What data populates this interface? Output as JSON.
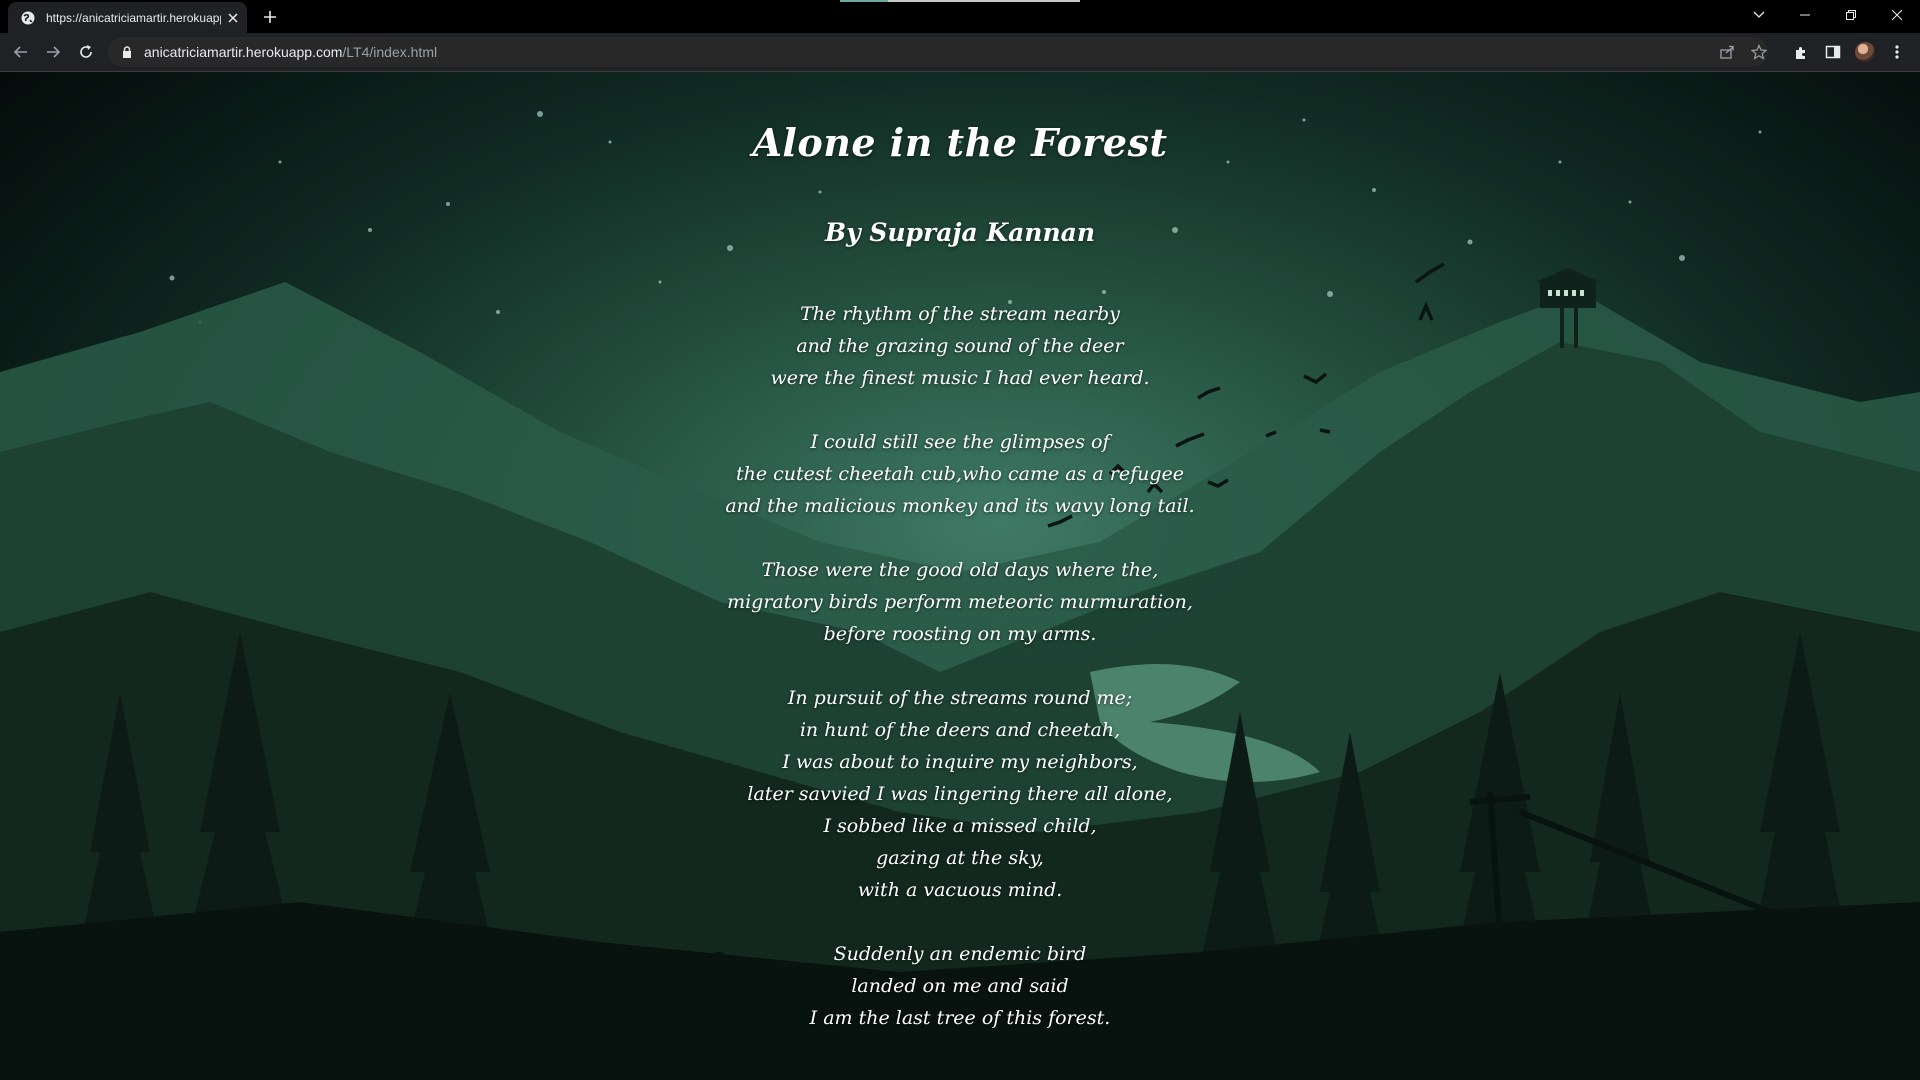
{
  "browser": {
    "tab_title": "https://anicatriciamartir.herokuapp.com/LT4/index.html",
    "url_host": "anicatriciamartir.herokuapp.com",
    "url_path": "/LT4/index.html"
  },
  "poem": {
    "title": "Alone in the Forest",
    "author": "By Supraja Kannan",
    "stanzas": [
      {
        "lines": [
          "The rhythm of the stream nearby",
          "and the grazing sound of the deer",
          "were the finest music I had ever heard."
        ]
      },
      {
        "lines": [
          "I could still see the glimpses of",
          "the cutest cheetah cub,who came as a refugee",
          "and the malicious monkey and its wavy long tail."
        ]
      },
      {
        "lines": [
          "Those were the good old days where the,",
          "migratory birds perform meteoric murmuration,",
          "before roosting on my arms."
        ]
      },
      {
        "lines": [
          "In pursuit of the streams round me;",
          "in hunt of the deers and cheetah,",
          "I was about to inquire my neighbors,",
          "later savvied I was lingering there all alone,",
          "I sobbed like a missed child,",
          "gazing at the sky,",
          "with a vacuous mind."
        ]
      },
      {
        "lines": [
          "Suddenly an endemic bird",
          "landed on me and said",
          "I am the last tree of this forest."
        ]
      }
    ]
  },
  "colors": {
    "chrome_bg": "#202124",
    "page_glow": "#3f7a66",
    "text": "#ffffff"
  }
}
